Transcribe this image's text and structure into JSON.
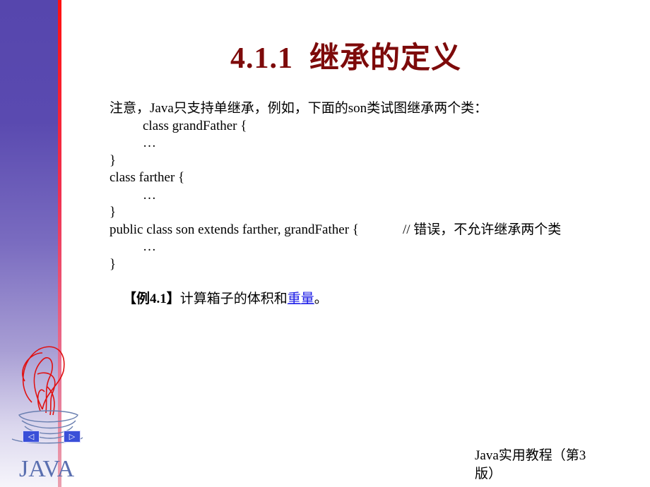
{
  "slide": {
    "title": "4.1.1  继承的定义",
    "intro": "注意，Java只支持单继承，例如，下面的son类试图继承两个类：",
    "code_lines": [
      {
        "text": "class grandFather {",
        "indent": true
      },
      {
        "text": "…",
        "indent": true
      },
      {
        "text": "}",
        "indent": false
      },
      {
        "text": "class farther {",
        "indent": false
      },
      {
        "text": "…",
        "indent": true
      },
      {
        "text": "}",
        "indent": false
      },
      {
        "text": "public class son extends farther, grandFather {",
        "indent": false,
        "comment": "// 错误，不允许继承两个类"
      },
      {
        "text": "…",
        "indent": true
      },
      {
        "text": "}",
        "indent": false
      }
    ],
    "example": {
      "tag": "【例4.1】",
      "text": "计算箱子的体积和",
      "link": "重量",
      "end": "。"
    },
    "footer": "Java实用教程（第3版）"
  },
  "sidebar": {
    "logo_text": "JAVA",
    "prev_icon": "◁",
    "next_icon": "▷"
  },
  "colors": {
    "title": "#7d0a0a",
    "link": "#1a1ae6",
    "sidebar_top": "#5646ad",
    "accent_line": "#ff1010"
  }
}
